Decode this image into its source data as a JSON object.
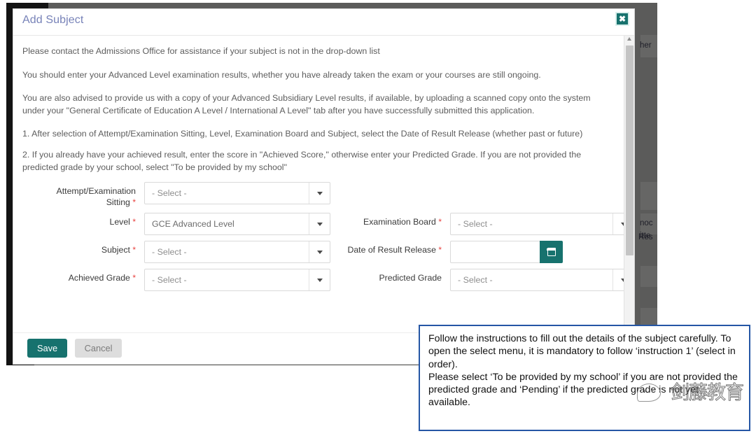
{
  "modal": {
    "title": "Add Subject",
    "close_icon": "close-icon",
    "paragraphs": [
      "Please contact the Admissions Office for assistance if your subject is not in the drop-down list",
      "You should enter your Advanced Level examination results, whether you have already taken the exam or your courses are still ongoing.",
      "You are also advised to provide us with a copy of your Advanced Subsidiary Level results, if available, by uploading a scanned copy onto the system under your \"General Certificate of Education A Level / International A Level\" tab after you have successfully submitted this application.",
      "1. After selection of Attempt/Examination Sitting, Level, Examination Board and Subject, select the Date of Result Release (whether past or future)",
      "2. If you already have your achieved result, enter the score in \"Achieved Score,\" otherwise enter your Predicted Grade. If you are not provided the predicted grade by your school, select \"To be provided by my school\""
    ]
  },
  "form": {
    "attempt": {
      "label": "Attempt/Examination Sitting",
      "required": "*",
      "value": "- Select -",
      "arrow_icon": "chevron-down-icon"
    },
    "level": {
      "label": "Level",
      "required": "*",
      "value": "GCE Advanced Level",
      "arrow_icon": "chevron-down-icon"
    },
    "subject": {
      "label": "Subject",
      "required": "*",
      "value": "- Select -",
      "arrow_icon": "chevron-down-icon"
    },
    "achieved_grade": {
      "label": "Achieved Grade",
      "required": "*",
      "value": "- Select -",
      "arrow_icon": "chevron-down-icon"
    },
    "examination_board": {
      "label": "Examination Board",
      "required": "*",
      "value": "- Select -",
      "arrow_icon": "chevron-down-icon"
    },
    "date_of_result_release": {
      "label": "Date of Result Release",
      "required": "*",
      "value": "",
      "calendar_icon": "calendar-icon"
    },
    "predicted_grade": {
      "label": "Predicted Grade",
      "required": "",
      "value": "- Select -",
      "arrow_icon": "chevron-down-icon"
    }
  },
  "footer": {
    "save_label": "Save",
    "cancel_label": "Cancel"
  },
  "callout": {
    "line1": "Follow the instructions to fill out the details of the subject carefully. To open the select menu, it is mandatory to follow ‘instruction 1’ (select in order).",
    "line2": "Please select ‘To be provided by my school’ if you are not provided the predicted grade and ‘Pending’ if the predicted grade is not yet available."
  },
  "background": {
    "ghost_1": "her",
    "ghost_2": "noc",
    "ghost_3": "itte",
    "ghost_4": "Res"
  },
  "watermark": {
    "text": "剑藤教育",
    "logo_icon": "wechat-bubble-icon"
  },
  "colors": {
    "accent_teal": "#17726e",
    "title_blue": "#7782b8",
    "required_red": "#e8423f",
    "callout_border": "#2556a5"
  }
}
